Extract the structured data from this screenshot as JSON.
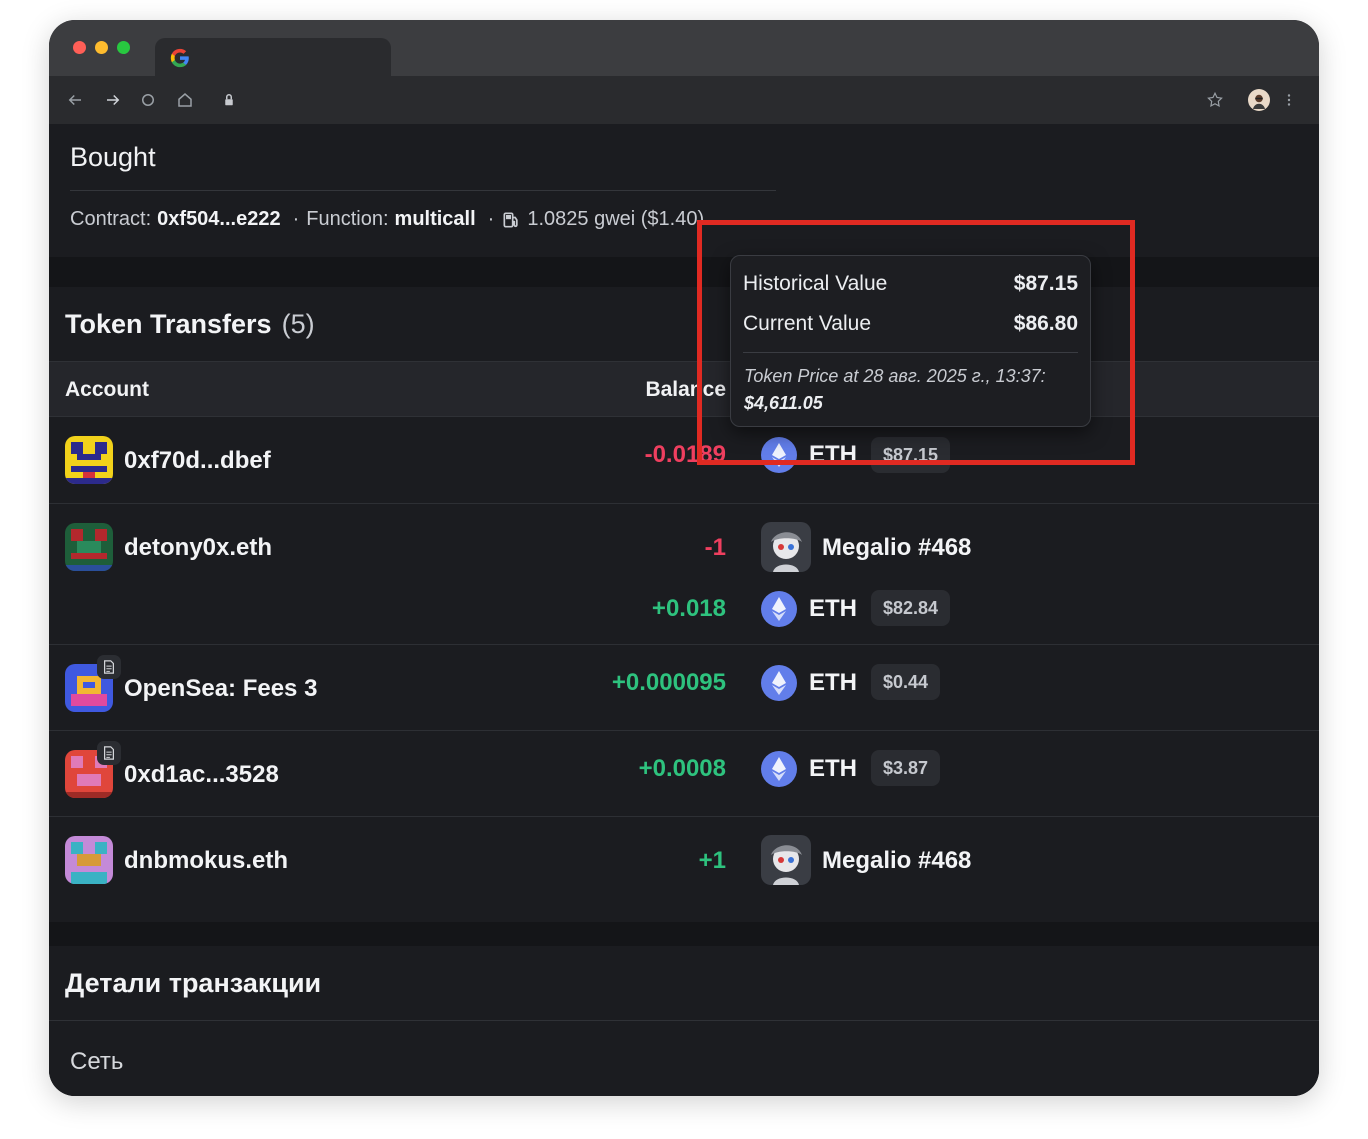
{
  "browser": {
    "icons": [
      "back-arrow-icon",
      "forward-arrow-icon",
      "reload-icon",
      "home-icon",
      "lock-icon",
      "star-icon",
      "profile-avatar",
      "more-vert-icon"
    ]
  },
  "top_card": {
    "title": "Bought",
    "contract_label": "Contract:",
    "contract_value": "0xf504...e222",
    "function_label": "Function:",
    "function_value": "multicall",
    "gas_text": "1.0825 gwei ($1.40)",
    "separator": "·"
  },
  "token_transfers": {
    "title": "Token Transfers",
    "count": "(5)",
    "col_account": "Account",
    "col_balance": "Balance",
    "rows": [
      {
        "account": "0xf70d...dbef",
        "lines": [
          {
            "balance": "-0.0189",
            "token": "ETH",
            "usd": "$87.15"
          }
        ]
      },
      {
        "account": "detony0x.eth",
        "lines": [
          {
            "balance": "-1",
            "nft": "Megalio #468"
          },
          {
            "balance": "+0.018",
            "token": "ETH",
            "usd": "$82.84"
          }
        ]
      },
      {
        "account": "OpenSea: Fees 3",
        "contract": true,
        "lines": [
          {
            "balance": "+0.000095",
            "token": "ETH",
            "usd": "$0.44"
          }
        ]
      },
      {
        "account": "0xd1ac...3528",
        "contract": true,
        "lines": [
          {
            "balance": "+0.0008",
            "token": "ETH",
            "usd": "$3.87"
          }
        ]
      },
      {
        "account": "dnbmokus.eth",
        "lines": [
          {
            "balance": "+1",
            "nft": "Megalio #468"
          }
        ]
      }
    ]
  },
  "tooltip": {
    "historical_label": "Historical Value",
    "historical_value": "$87.15",
    "current_label": "Current Value",
    "current_value": "$86.80",
    "price_label": "Token Price at 28 авг. 2025 г., 13:37:",
    "price_value": "$4,611.05"
  },
  "details": {
    "title": "Детали транзакции",
    "network_label": "Сеть"
  },
  "colors": {
    "negative": "#ef3f5f",
    "positive": "#2ec27e",
    "highlight": "#e02a22",
    "eth": "#627eea"
  }
}
